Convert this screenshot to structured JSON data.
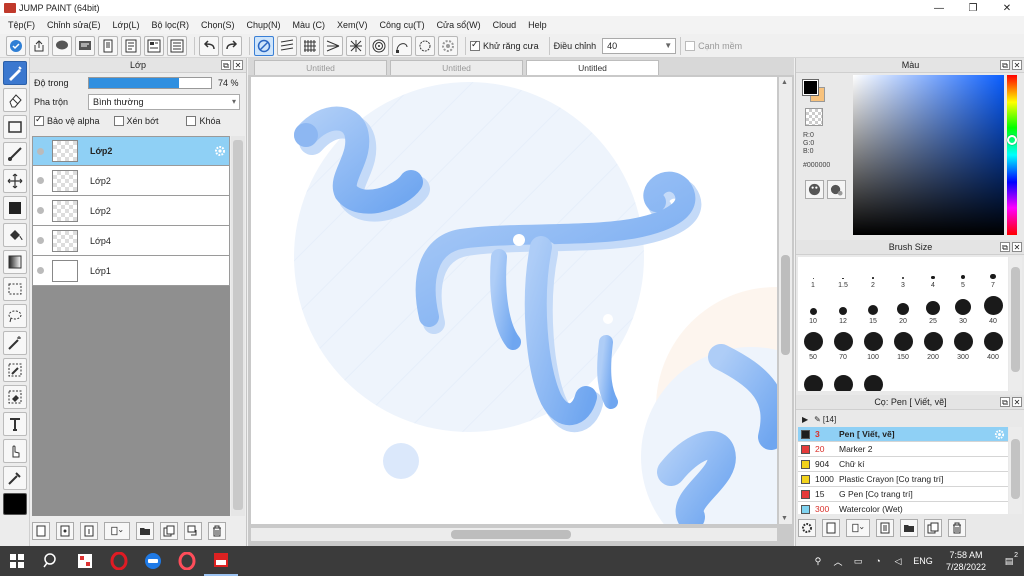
{
  "window": {
    "title": "JUMP PAINT (64bit)",
    "minimize": "—",
    "maximize": "❐",
    "close": "✕"
  },
  "menu": [
    "Tệp(F)",
    "Chỉnh sửa(E)",
    "Lớp(L)",
    "Bộ lọc(R)",
    "Chọn(S)",
    "Chụp(N)",
    "Màu (C)",
    "Xem(V)",
    "Công cụ(T)",
    "Cửa sổ(W)",
    "Cloud",
    "Help"
  ],
  "toolbar": {
    "antialias_label": "Khử răng cưa",
    "adjust_label": "Điều chỉnh",
    "adjust_value": "40",
    "snap_label": "Cạnh mềm"
  },
  "layer_panel": {
    "title": "Lớp",
    "opacity_label": "Độ trong",
    "opacity_value": "74 %",
    "opacity_fraction": 0.74,
    "blend_label": "Pha trộn",
    "blend_value": "Bình thường",
    "protect_alpha": "Bảo vệ alpha",
    "clipping": "Xén bớt",
    "lock": "Khóa",
    "layers": [
      {
        "name": "Lớp2",
        "selected": true
      },
      {
        "name": "Lớp2",
        "selected": false
      },
      {
        "name": "Lớp2",
        "selected": false
      },
      {
        "name": "Lớp4",
        "selected": false
      },
      {
        "name": "Lớp1",
        "selected": false
      }
    ]
  },
  "tabs": [
    "Untitled",
    "Untitled",
    "Untitled"
  ],
  "color_panel": {
    "title": "Màu",
    "r": "R:0",
    "g": "G:0",
    "b": "B:0",
    "hex": "#000000",
    "fg": "#000000",
    "bg": "#f8c27c"
  },
  "brush_panel": {
    "title": "Brush Size",
    "sizes": [
      "1",
      "1.5",
      "2",
      "3",
      "4",
      "5",
      "7",
      "10",
      "12",
      "15",
      "20",
      "25",
      "30",
      "40",
      "50",
      "70",
      "100",
      "150",
      "200",
      "300",
      "400",
      "",
      "",
      ""
    ]
  },
  "pen_panel": {
    "title": "Cọ: Pen [ Viết, vẽ]",
    "group": "[14]",
    "pens": [
      {
        "size": "3",
        "name": "Pen [ Viết, vẽ]",
        "color": "#1e1e1e",
        "selected": true
      },
      {
        "size": "20",
        "name": "Marker 2",
        "color": "#e53b3b",
        "selected": false
      },
      {
        "size": "904",
        "name": "Chữ kí",
        "color": "#f2d21b",
        "selected": false
      },
      {
        "size": "1000",
        "name": "Plastic Crayon [Cọ trang trí]",
        "color": "#f2d21b",
        "selected": false
      },
      {
        "size": "15",
        "name": "G Pen [Cọ trang trí]",
        "color": "#e53b3b",
        "selected": false
      },
      {
        "size": "300",
        "name": "Watercolor (Wet)",
        "color": "#7fd3f0",
        "selected": false
      }
    ]
  },
  "taskbar": {
    "lang": "ENG",
    "time": "7:58 AM",
    "date": "7/28/2022",
    "notifications": "2"
  }
}
